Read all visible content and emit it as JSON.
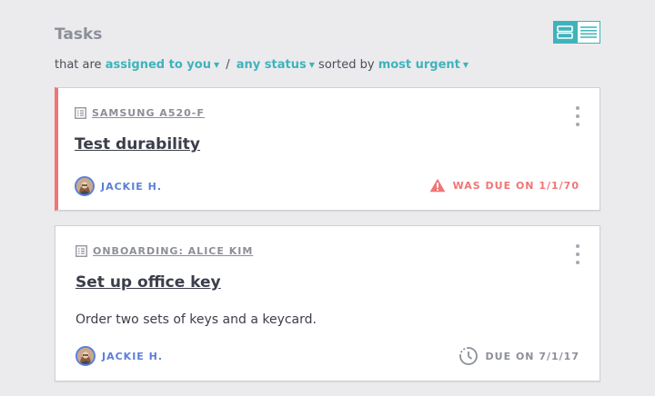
{
  "header": {
    "title": "Tasks",
    "view_toggle": {
      "active": "cards",
      "options": [
        "cards-view-icon",
        "list-view-icon"
      ]
    }
  },
  "filter": {
    "prefix": "that are",
    "assignment": "assigned to you",
    "separator": "/",
    "status": "any status",
    "sorted_by_label": "sorted by",
    "sort": "most urgent"
  },
  "tasks": [
    {
      "context": "SAMSUNG A520-F",
      "title": "Test durability",
      "description": "",
      "assignee": "JACKIE H.",
      "due": "WAS DUE ON 1/1/70",
      "overdue": true,
      "icon": "warning-icon"
    },
    {
      "context": "ONBOARDING: ALICE KIM",
      "title": "Set up office key",
      "description": "Order two sets of keys and a keycard.",
      "assignee": "JACKIE H.",
      "due": "DUE ON 7/1/17",
      "overdue": false,
      "icon": "clock-icon"
    }
  ],
  "colors": {
    "accent": "#3fb3bc",
    "overdue": "#f07576",
    "assignee": "#5b7fd8",
    "muted": "#8c8f99",
    "background": "#ebebed"
  }
}
